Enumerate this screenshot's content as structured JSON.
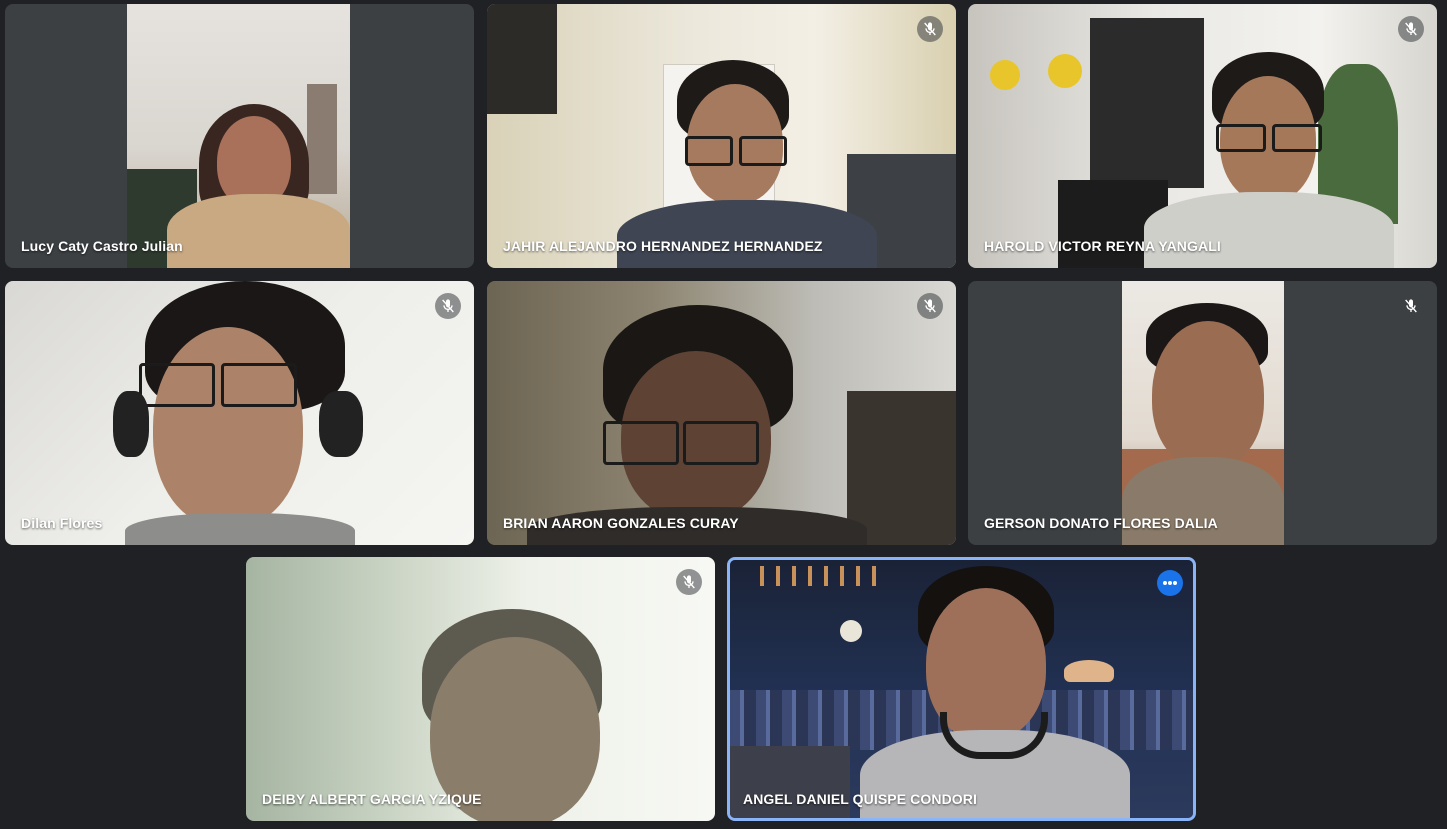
{
  "participants": [
    {
      "name": "Lucy Caty Castro Julian",
      "muted": false
    },
    {
      "name": "JAHIR ALEJANDRO HERNANDEZ HERNANDEZ",
      "muted": true
    },
    {
      "name": "HAROLD VICTOR REYNA YANGALI",
      "muted": true
    },
    {
      "name": "Dilan Flores",
      "muted": true
    },
    {
      "name": "BRIAN AARON GONZALES CURAY",
      "muted": true
    },
    {
      "name": "GERSON DONATO FLORES DALIA",
      "muted": true
    },
    {
      "name": "DEIBY ALBERT GARCIA YZIQUE",
      "muted": true
    },
    {
      "name": "ANGEL DANIEL QUISPE CONDORI",
      "muted": false,
      "active_speaker": true
    }
  ],
  "icons": {
    "muted": "mic-off-icon",
    "more": "more-options-icon"
  },
  "colors": {
    "background": "#202124",
    "tile_background": "#3c4043",
    "active_border": "#8ab4f8",
    "more_button": "#1a73e8"
  }
}
